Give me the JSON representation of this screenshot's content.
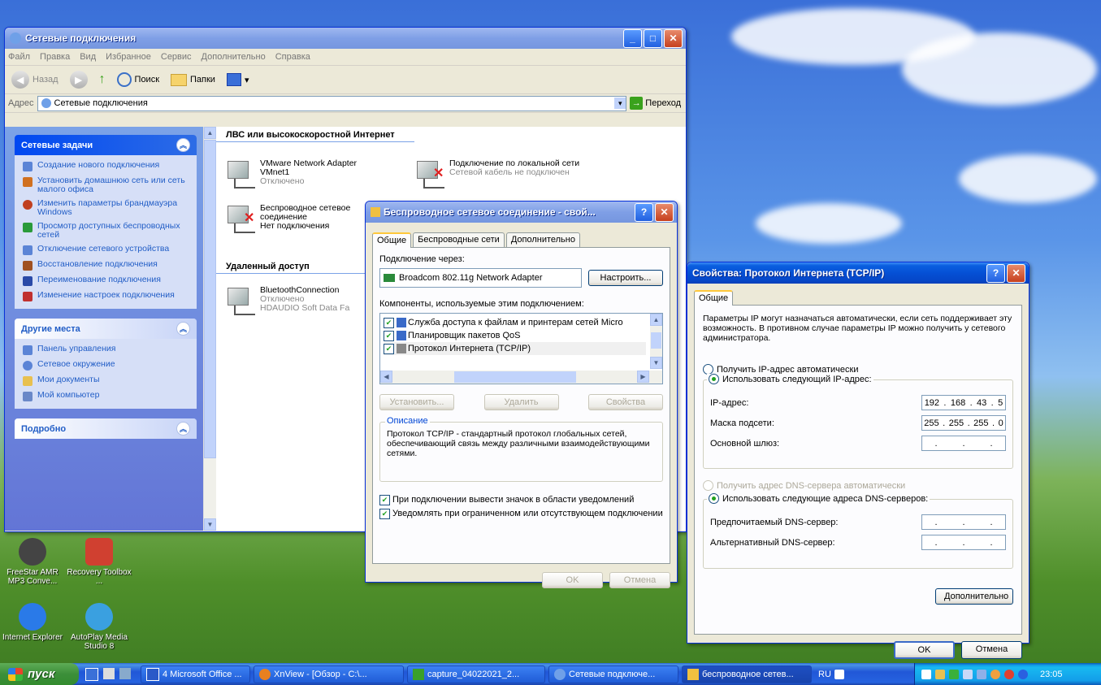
{
  "desktop": {
    "icons": [
      {
        "label": "FreeStar AMR MP3 Conve...",
        "color": "#444444"
      },
      {
        "label": "Recovery Toolbox ...",
        "color": "#d04030"
      },
      {
        "label": "Internet Explorer",
        "color": "#2a7ae8"
      },
      {
        "label": "AutoPlay Media Studio 8",
        "color": "#3aa0e0"
      }
    ]
  },
  "explorer": {
    "title": "Сетевые подключения",
    "menu": [
      "Файл",
      "Правка",
      "Вид",
      "Избранное",
      "Сервис",
      "Дополнительно",
      "Справка"
    ],
    "toolbar": {
      "back": "Назад",
      "search": "Поиск",
      "folders": "Папки"
    },
    "address_label": "Адрес",
    "address_value": "Сетевые подключения",
    "go_label": "Переход",
    "tasks": {
      "network_title": "Сетевые задачи",
      "network_items": [
        "Создание нового подключения",
        "Установить домашнюю сеть или сеть малого офиса",
        "Изменить параметры брандмауэра Windows",
        "Просмотр доступных беспроводных сетей",
        "Отключение сетевого устройства",
        "Восстановление подключения",
        "Переименование подключения",
        "Изменение настроек подключения"
      ],
      "other_title": "Другие места",
      "other_items": [
        "Панель управления",
        "Сетевое окружение",
        "Мои документы",
        "Мой компьютер"
      ],
      "details_title": "Подробно"
    },
    "groups": {
      "lan_title": "ЛВС или высокоскоростной Интернет",
      "remote_title": "Удаленный доступ"
    },
    "connections": [
      {
        "name": "VMware Network Adapter VMnet1",
        "status": "Отключено"
      },
      {
        "name": "Подключение по локальной сети",
        "status": "Сетевой кабель не подключен"
      },
      {
        "name": "Беспроводное сетевое соединение",
        "status": "Нет подключения"
      },
      {
        "name": "BluetoothConnection",
        "status": "Отключено",
        "device": "HDAUDIO Soft Data Fa"
      }
    ]
  },
  "wireless_dialog": {
    "title": "Беспроводное сетевое соединение - свой...",
    "tabs": [
      "Общие",
      "Беспроводные сети",
      "Дополнительно"
    ],
    "connect_via_label": "Подключение через:",
    "adapter": "Broadcom 802.11g Network Adapter",
    "configure_button": "Настроить...",
    "components_label": "Компоненты, используемые этим подключением:",
    "components": [
      {
        "label": "Служба доступа к файлам и принтерам сетей Micro",
        "checked": true
      },
      {
        "label": "Планировщик пакетов QoS",
        "checked": true
      },
      {
        "label": "Протокол Интернета (TCP/IP)",
        "checked": true
      }
    ],
    "install_button": "Установить...",
    "remove_button": "Удалить",
    "properties_button": "Свойства",
    "description_legend": "Описание",
    "description_text": "Протокол TCP/IP - стандартный протокол глобальных сетей, обеспечивающий связь между различными взаимодействующими сетями.",
    "show_icon_label": "При подключении вывести значок в области уведомлений",
    "notify_label": "Уведомлять при ограниченном или отсутствующем подключении",
    "ok_button": "OK",
    "cancel_button": "Отмена"
  },
  "tcpip_dialog": {
    "title": "Свойства: Протокол Интернета (TCP/IP)",
    "tab": "Общие",
    "intro": "Параметры IP могут назначаться автоматически, если сеть поддерживает эту возможность. В противном случае параметры IP можно получить у сетевого администратора.",
    "auto_ip_label": "Получить IP-адрес автоматически",
    "manual_ip_label": "Использовать следующий IP-адрес:",
    "ip_label": "IP-адрес:",
    "ip_value": [
      "192",
      "168",
      "43",
      "5"
    ],
    "mask_label": "Маска подсети:",
    "mask_value": [
      "255",
      "255",
      "255",
      "0"
    ],
    "gateway_label": "Основной шлюз:",
    "auto_dns_label": "Получить адрес DNS-сервера автоматически",
    "manual_dns_label": "Использовать следующие адреса DNS-серверов:",
    "preferred_dns_label": "Предпочитаемый DNS-сервер:",
    "alternate_dns_label": "Альтернативный DNS-сервер:",
    "advanced_button": "Дополнительно",
    "ok_button": "OK",
    "cancel_button": "Отмена"
  },
  "taskbar": {
    "start_label": "пуск",
    "apps": [
      "4 Microsoft Office ...",
      "XnView - [Обзор - C:\\...",
      "capture_04022021_2...",
      "Сетевые подключе...",
      "беспроводное сетев..."
    ],
    "lang": "RU",
    "clock": "23:05"
  }
}
